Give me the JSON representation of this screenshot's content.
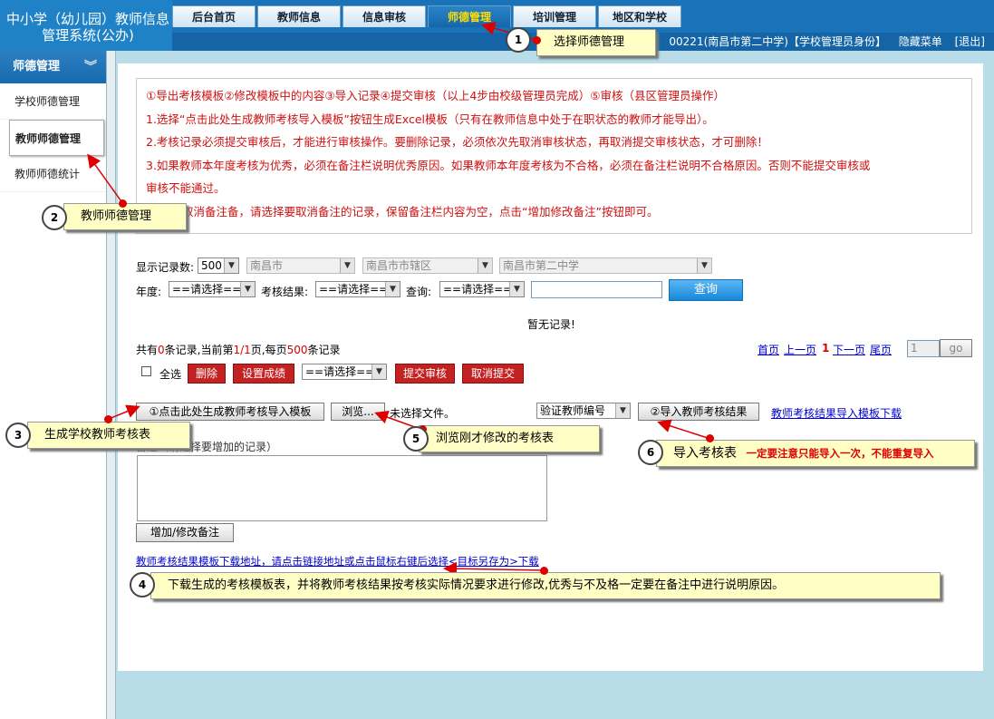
{
  "header": {
    "logo": "中小学（幼儿园）教师信息管理系统(公办)",
    "tabs": [
      {
        "label": "后台首页"
      },
      {
        "label": "教师信息"
      },
      {
        "label": "信息审核"
      },
      {
        "label": "师德管理"
      },
      {
        "label": "培训管理"
      },
      {
        "label": "地区和学校"
      }
    ],
    "user_info": "00221(南昌市第二中学)【学校管理员身份】",
    "hide_menu": "隐藏菜单",
    "logout": "[退出]"
  },
  "sidebar": {
    "title": "师德管理",
    "items": [
      {
        "label": "学校师德管理"
      },
      {
        "label": "教师师德管理"
      },
      {
        "label": "教师师德统计"
      }
    ]
  },
  "notice": {
    "lines": [
      "①导出考核模板②修改模板中的内容③导入记录④提交审核（以上4步由校级管理员完成）⑤审核（县区管理员操作）",
      "1.选择“点击此处生成教师考核导入模板”按钮生成Excel模板（只有在教师信息中处于在职状态的教师才能导出）。",
      "2.考核记录必须提交审核后，才能进行审核操作。要删除记录，必须依次先取消审核状态，再取消提交审核状态，才可删除！",
      "3.如果教师本年度考核为优秀，必须在备注栏说明优秀原因。如果教师本年度考核为不合格，必须在备注栏说明不合格原因。否则不能提交审核或",
      "审核不能通过。",
      "取消备注备，请选择要取消备注的记录，保留备注栏内容为空，点击“增加修改备注”按钮即可。"
    ]
  },
  "filters": {
    "records_label": "显示记录数:",
    "records_value": "500",
    "city": "南昌市",
    "district": "南昌市市辖区",
    "school": "南昌市第二中学",
    "year_label": "年度:",
    "year_value": "==请选择==",
    "result_label": "考核结果:",
    "result_value": "==请选择==",
    "query_label": "查询:",
    "query_value": "==请选择==",
    "query_input": "",
    "search_button": "查询"
  },
  "table": {
    "empty_text": "暂无记录!"
  },
  "pagination": {
    "p1": "共有",
    "count": "0",
    "p2": "条记录,当前第",
    "page": "1/1",
    "p3": "页,每页",
    "per_page": "500",
    "p4": "条记录",
    "first": "首页",
    "prev": "上一页",
    "current": "1",
    "next": "下一页",
    "last": "尾页",
    "page_input": "1",
    "go": "go"
  },
  "actions": {
    "select_all": "全选",
    "delete": "删除",
    "set_score": "设置成绩",
    "choose": "==请选择==",
    "submit_review": "提交审核",
    "cancel_submit": "取消提交"
  },
  "import": {
    "generate_template": "①点击此处生成教师考核导入模板",
    "browse": "浏览...",
    "no_file": "未选择文件。",
    "verify_select": "验证教师编号",
    "import_results": "②导入教师考核结果",
    "download_template": "教师考核结果导入模板下载",
    "remark_label": "备注（请选择要增加的记录）",
    "remark_value": "",
    "add_remark": "增加/修改备注",
    "download_hint": "教师考核结果模板下载地址，请点击链接地址或点击鼠标右键后选择<目标另存为>下载"
  },
  "callouts": [
    {
      "num": "1",
      "text": "选择师德管理"
    },
    {
      "num": "2",
      "text": "教师师德管理"
    },
    {
      "num": "3",
      "text": "生成学校教师考核表"
    },
    {
      "num": "4",
      "text": "下载生成的考核模板表，并将教师考核结果按考核实际情况要求进行修改,优秀与不及格一定要在备注中进行说明原因。"
    },
    {
      "num": "5",
      "text": "浏览刚才修改的考核表"
    },
    {
      "num": "6",
      "text": "导入考核表",
      "warning": "一定要注意只能导入一次，不能重复导入"
    }
  ],
  "colors": {
    "header_blue": "#1a72b8",
    "active_tab_text": "#ffde00",
    "notice_red": "#d01010",
    "action_red": "#c42222",
    "search_blue": "#1987d9",
    "callout_bg": "#fffec4"
  }
}
